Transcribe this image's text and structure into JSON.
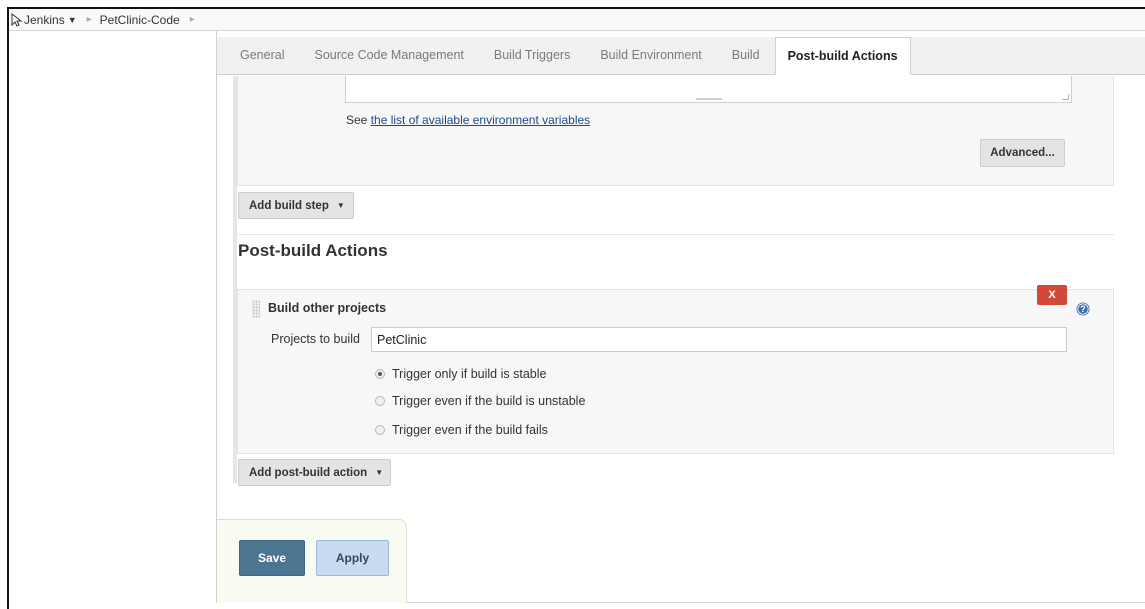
{
  "breadcrumb": {
    "items": [
      "Jenkins",
      "PetClinic-Code"
    ]
  },
  "tabs": [
    "General",
    "Source Code Management",
    "Build Triggers",
    "Build Environment",
    "Build",
    "Post-build Actions"
  ],
  "active_tab": "Post-build Actions",
  "build": {
    "see_prefix": "See",
    "env_link": "the list of available environment variables",
    "advanced_label": "Advanced...",
    "add_step_label": "Add build step"
  },
  "post_build": {
    "section_title": "Post-build Actions",
    "action_title": "Build other projects",
    "close_label": "X",
    "projects_label": "Projects to build",
    "projects_value": "PetClinic",
    "radio_options": [
      "Trigger only if build is stable",
      "Trigger even if the build is unstable",
      "Trigger even if the build fails"
    ],
    "selected_option": "Trigger only if build is stable",
    "add_action_label": "Add post-build action"
  },
  "footer": {
    "save_label": "Save",
    "apply_label": "Apply"
  },
  "colors": {
    "save": "#4b7591",
    "apply": "#c8dbef",
    "close": "#d24939",
    "link": "#204a87"
  }
}
